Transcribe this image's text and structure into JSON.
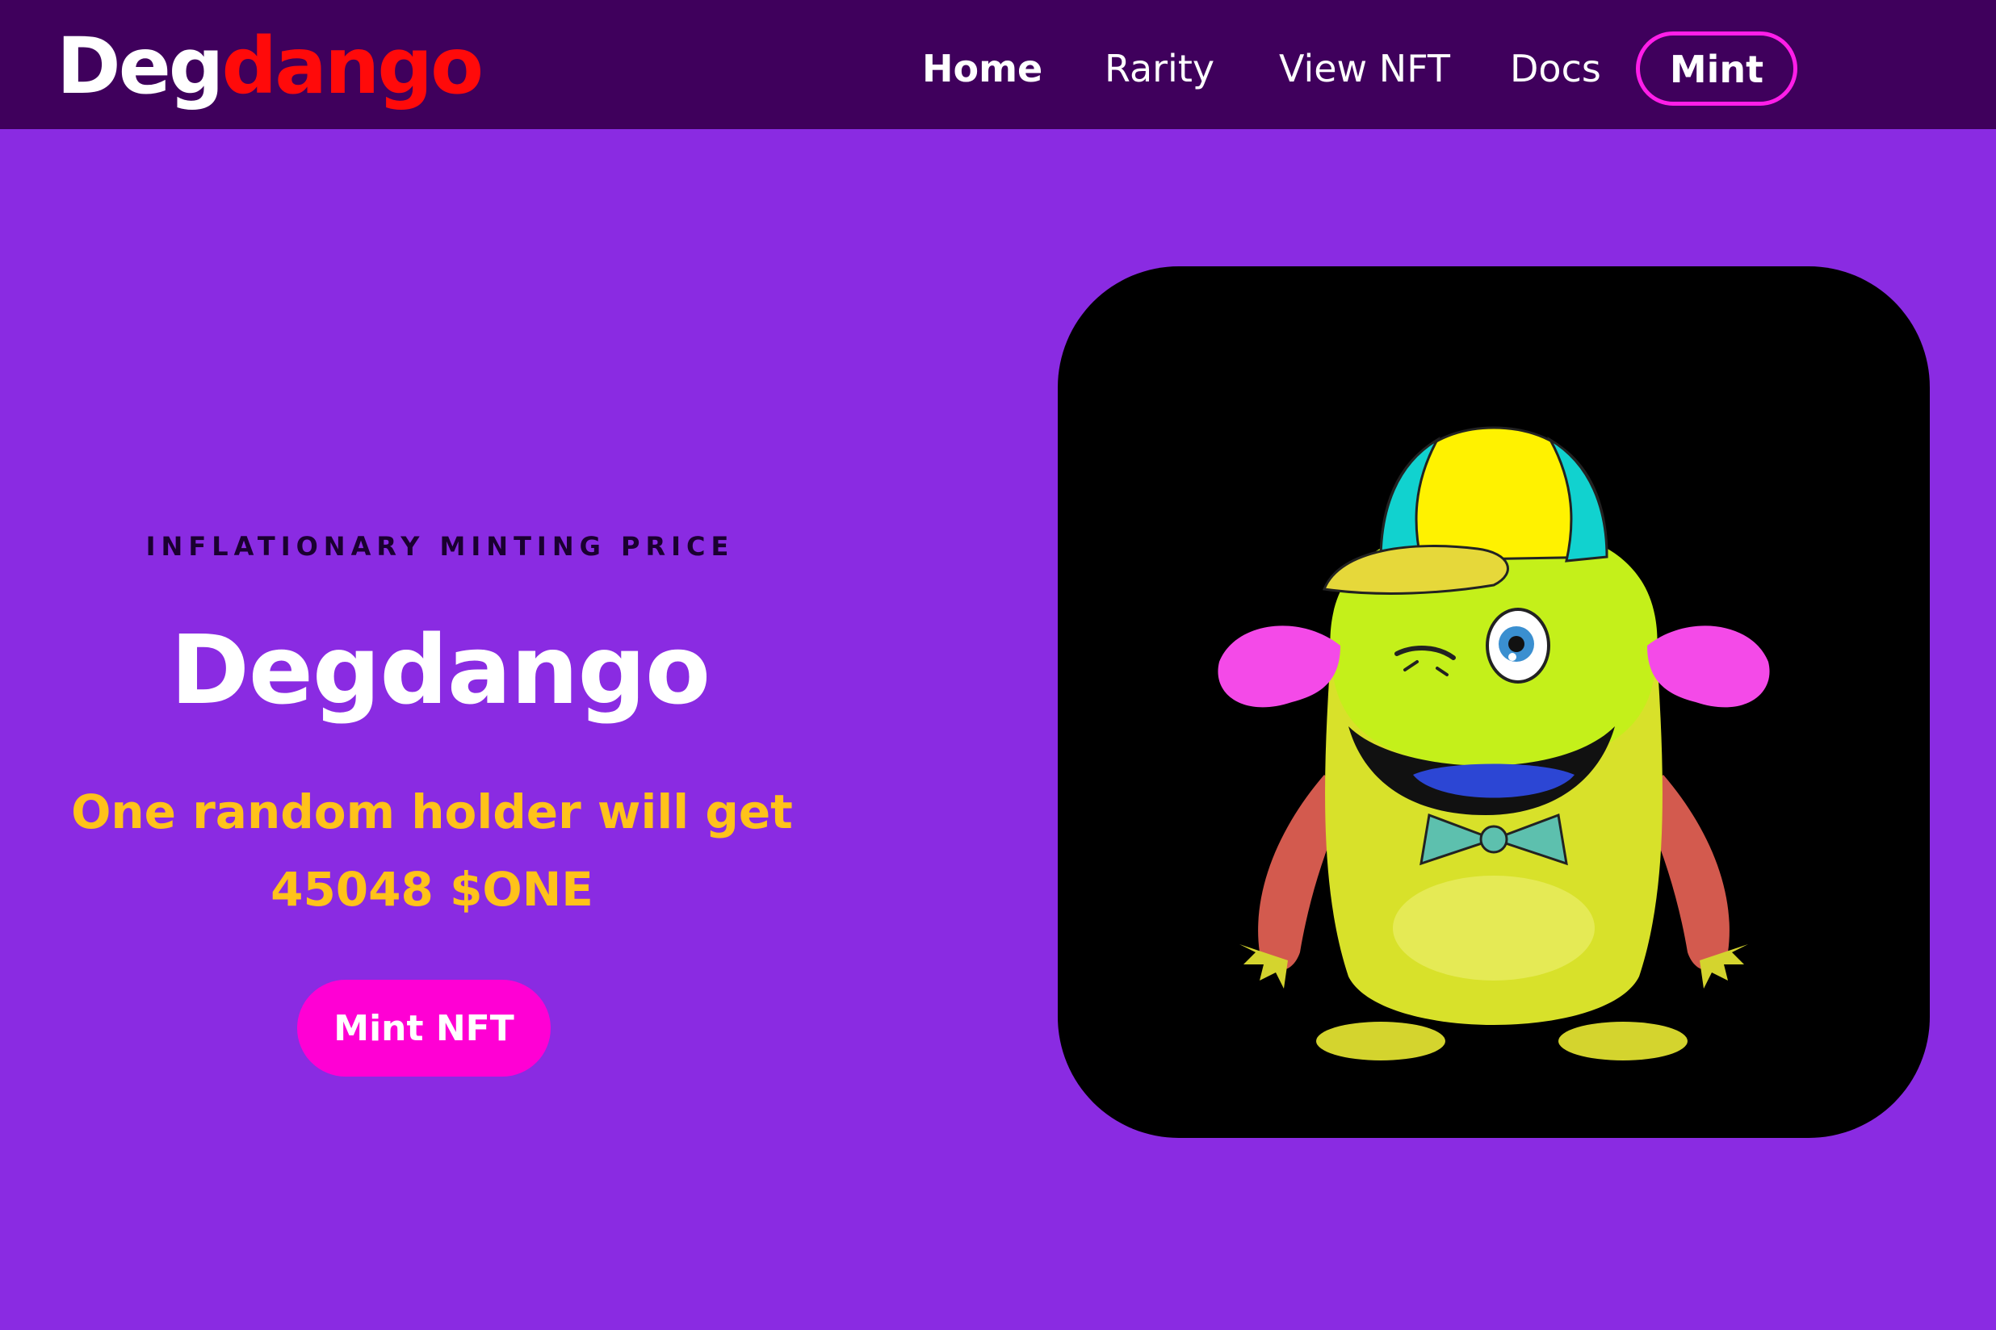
{
  "brand": {
    "part1": "Deg",
    "part2": "dango",
    "part1_color": "#ffffff",
    "part2_color": "#ff0a0a"
  },
  "nav": {
    "home": "Home",
    "rarity": "Rarity",
    "view_nft": "View NFT",
    "docs": "Docs",
    "mint": "Mint"
  },
  "hero": {
    "eyebrow": "INFLATIONARY MINTING PRICE",
    "title": "Degdango",
    "subtitle": "One random holder will get 45048 $ONE",
    "cta": "Mint NFT"
  },
  "artwork": {
    "icon": "monster-nft-illustration-icon"
  },
  "colors": {
    "page_background": "#8a2be2",
    "navbar_background": "#3f005c",
    "accent_pink": "#ff00d4",
    "subtitle_gold": "#ffc21a"
  }
}
